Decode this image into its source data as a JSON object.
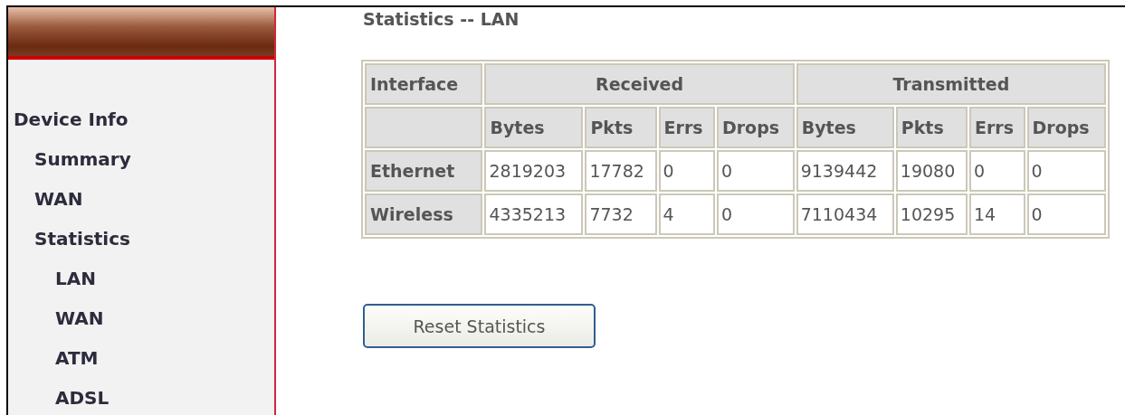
{
  "sidebar": {
    "items": [
      {
        "label": "Device Info",
        "children": [
          {
            "label": "Summary"
          },
          {
            "label": "WAN"
          },
          {
            "label": "Statistics",
            "children": [
              {
                "label": "LAN"
              },
              {
                "label": "WAN"
              },
              {
                "label": "ATM"
              },
              {
                "label": "ADSL"
              }
            ]
          }
        ]
      }
    ]
  },
  "page_title": "Statistics -- LAN",
  "table": {
    "group_headers": [
      "Interface",
      "Received",
      "Transmitted"
    ],
    "columns": [
      "Bytes",
      "Pkts",
      "Errs",
      "Drops",
      "Bytes",
      "Pkts",
      "Errs",
      "Drops"
    ],
    "rows": [
      {
        "interface": "Ethernet",
        "cells": [
          "2819203",
          "17782",
          "0",
          "0",
          "9139442",
          "19080",
          "0",
          "0"
        ]
      },
      {
        "interface": "Wireless",
        "cells": [
          "4335213",
          "7732",
          "4",
          "0",
          "7110434",
          "10295",
          "14",
          "0"
        ]
      }
    ]
  },
  "reset_button": "Reset Statistics"
}
